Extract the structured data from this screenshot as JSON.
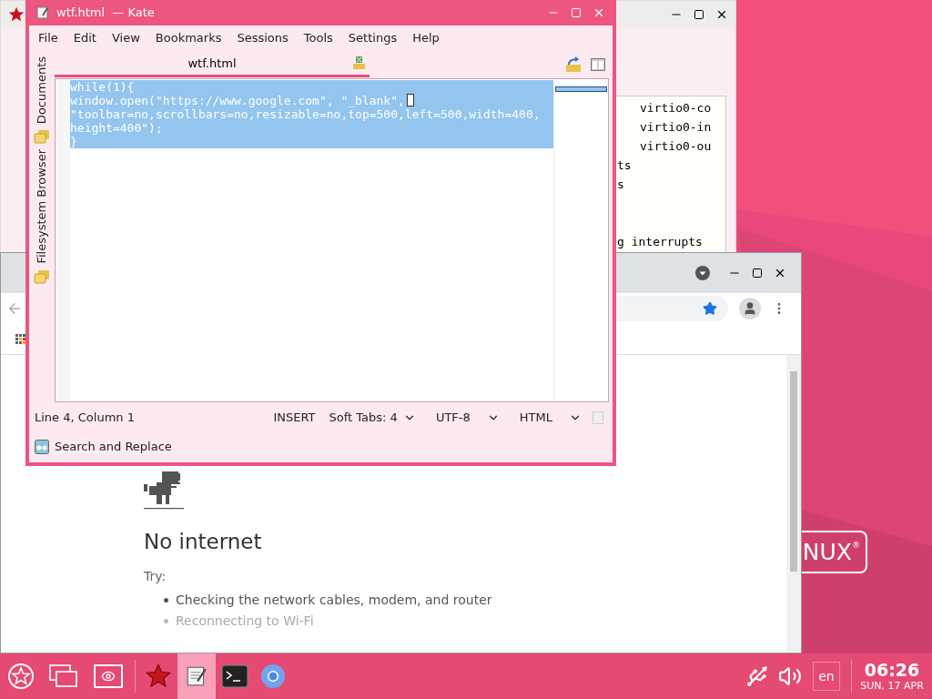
{
  "desktop": {
    "logo_text": "NUX",
    "logo_mark": "®"
  },
  "background_window": {
    "lines": [
      "virtio0-co",
      "virtio0-in",
      "virtio0-ou",
      "ts",
      "s",
      "g interrupts"
    ]
  },
  "browser": {
    "error_title": "No internet",
    "try_label": "Try:",
    "suggestions": [
      {
        "text": "Checking the network cables, modem, and router",
        "faded": false
      },
      {
        "text": "Reconnecting to Wi-Fi",
        "faded": true
      }
    ]
  },
  "kate": {
    "title": "wtf.html  — Kate",
    "menu": [
      "File",
      "Edit",
      "View",
      "Bookmarks",
      "Sessions",
      "Tools",
      "Settings",
      "Help"
    ],
    "sidebar_tabs": [
      "Documents",
      "Filesystem Browser"
    ],
    "document_tab": {
      "label": "wtf.html",
      "selected": true
    },
    "code": {
      "selected": true,
      "lines": [
        {
          "text": "while(1){",
          "cursor": false
        },
        {
          "text": "window.open(\"https://www.google.com\", \"_blank\",",
          "cursor": true
        },
        {
          "text": "\"toolbar=no,scrollbars=no,resizable=no,top=500,left=500,width=400,",
          "cursor": false
        },
        {
          "text": "height=400\");",
          "cursor": false
        },
        {
          "text": "}",
          "cursor": false
        }
      ]
    },
    "status": {
      "position": "Line 4, Column 1",
      "mode": "INSERT",
      "indentation": "Soft Tabs: 4",
      "encoding": "UTF-8",
      "syntax": "HTML"
    },
    "search_replace": "Search and Replace"
  },
  "taskbar": {
    "tasks": [
      {
        "kind": "app-star",
        "active": false
      },
      {
        "kind": "editor",
        "active": true
      },
      {
        "kind": "terminal",
        "active": false
      },
      {
        "kind": "browser",
        "active": false
      }
    ],
    "language": "en",
    "time": "06:26",
    "date": "SUN, 17 APR"
  }
}
